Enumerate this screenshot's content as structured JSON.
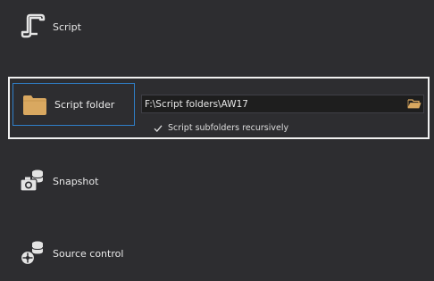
{
  "options": {
    "script": {
      "label": "Script",
      "icon": "script-scroll-icon"
    },
    "script_folder": {
      "label": "Script folder",
      "icon": "folder-icon",
      "path_value": "F:\\Script folders\\AW17",
      "browse_icon": "open-folder-icon",
      "recursive_label": "Script subfolders recursively",
      "recursive_checked": true
    },
    "snapshot": {
      "label": "Snapshot",
      "icon": "camera-database-icon"
    },
    "source_control": {
      "label": "Source control",
      "icon": "source-control-database-icon"
    }
  },
  "colors": {
    "background": "#2d2d30",
    "folder_icon": "#d9a860",
    "selected_border": "#2f7fc9",
    "group_border": "#f0f0f0",
    "input_background": "#1e1e1e"
  }
}
